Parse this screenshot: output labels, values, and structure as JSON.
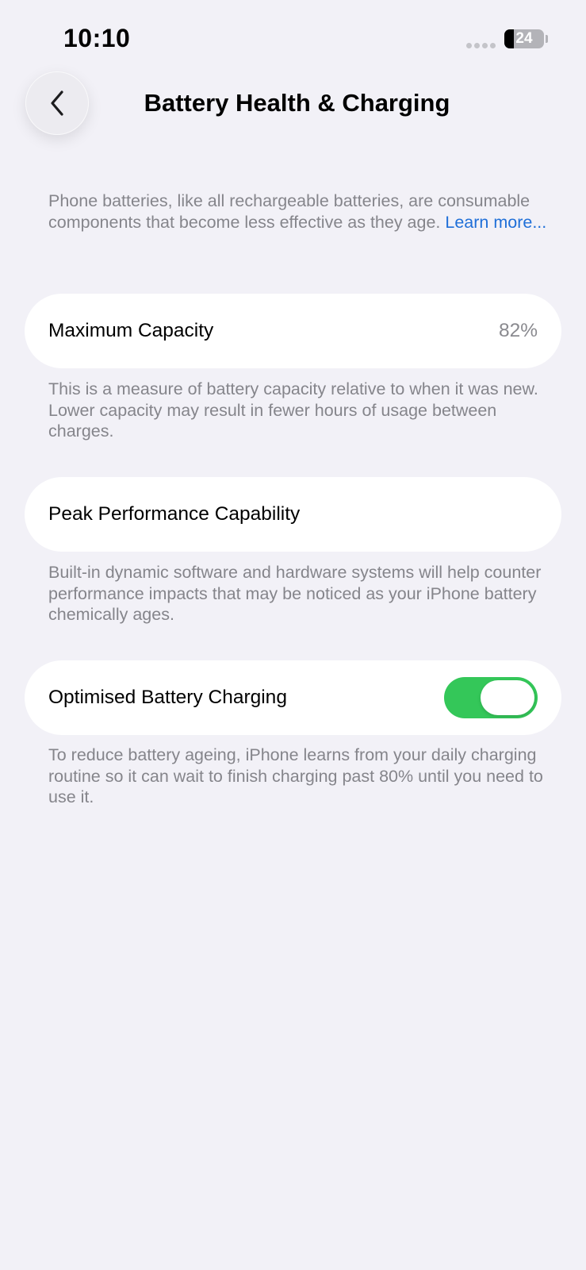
{
  "status_bar": {
    "time": "10:10",
    "battery_level": "24",
    "battery_fraction": 0.24
  },
  "nav": {
    "back_icon": "chevron-left-icon",
    "title": "Battery Health & Charging"
  },
  "intro": {
    "text": "Phone batteries, like all rechargeable batteries, are consumable components that become less effective as they age. ",
    "link": "Learn more..."
  },
  "maximum_capacity": {
    "label": "Maximum Capacity",
    "value": "82%",
    "description": "This is a measure of battery capacity relative to when it was new. Lower capacity may result in fewer hours of usage between charges."
  },
  "peak_performance": {
    "label": "Peak Performance Capability",
    "description": "Built-in dynamic software and hardware systems will help counter performance impacts that may be noticed as your iPhone battery chemically ages."
  },
  "optimised_charging": {
    "label": "Optimised Battery Charging",
    "enabled": true,
    "description": "To reduce battery ageing, iPhone learns from your daily charging routine so it can wait to finish charging past 80% until you need to use it."
  },
  "colors": {
    "background": "#f2f1f7",
    "card": "#ffffff",
    "secondary_text": "#85858b",
    "link": "#1f6fd8",
    "toggle_on": "#34c759"
  }
}
